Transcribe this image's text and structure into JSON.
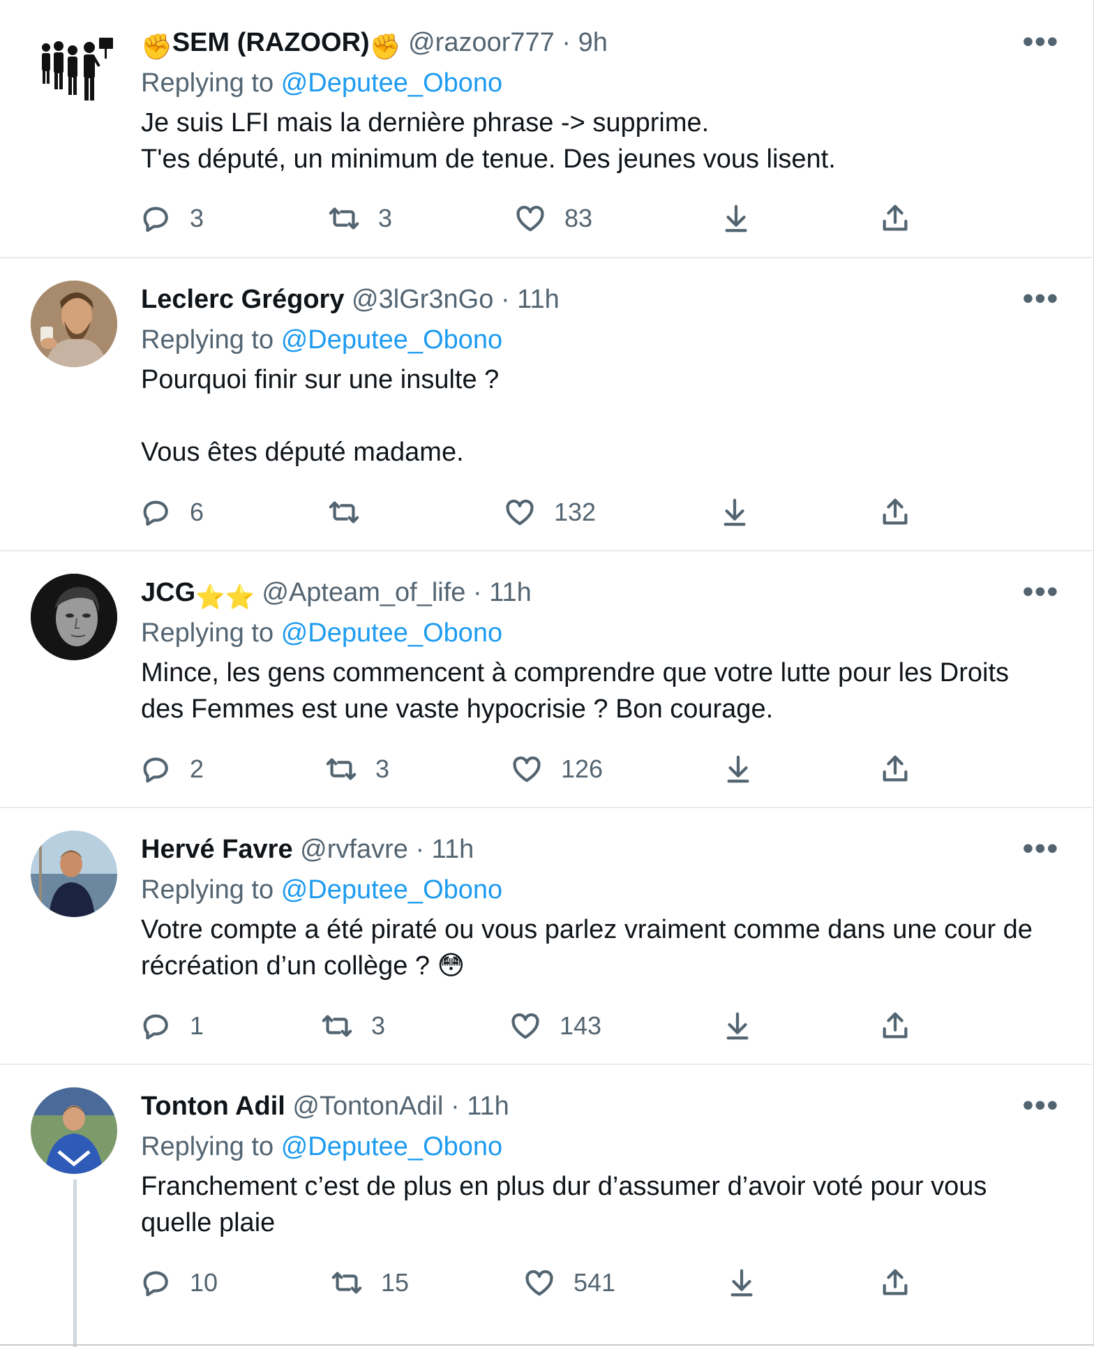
{
  "replying_label": "Replying to",
  "colors": {
    "accent": "#1d9bf0",
    "muted": "#536471",
    "text": "#0f1419",
    "divider": "#e6ecf0"
  },
  "icons": [
    "reply-icon",
    "retweet-icon",
    "like-icon",
    "download-icon",
    "share-icon",
    "more-icon"
  ],
  "tweets": [
    {
      "name": "SEM (RAZOOR)",
      "name_prefix_emoji": "✊",
      "name_suffix_emoji": "✊",
      "handle": "@razoor777",
      "sep": "·",
      "time": "9h",
      "reply_to": "@Deputee_Obono",
      "lines": [
        "Je suis LFI mais la dernière phrase -> supprime.",
        "T'es député, un minimum de tenue. Des jeunes vous lisent."
      ],
      "replies": "3",
      "retweets": "3",
      "likes": "83"
    },
    {
      "name": "Leclerc Grégory",
      "handle": "@3lGr3nGo",
      "sep": "·",
      "time": "11h",
      "reply_to": "@Deputee_Obono",
      "lines": [
        "Pourquoi finir sur une insulte ?",
        "",
        "Vous êtes député madame."
      ],
      "replies": "6",
      "retweets": "",
      "likes": "132"
    },
    {
      "name": "JCG",
      "name_suffix_emoji": "⭐⭐",
      "handle": "@Apteam_of_life",
      "sep": "·",
      "time": "11h",
      "reply_to": "@Deputee_Obono",
      "lines": [
        "Mince, les gens commencent à comprendre que votre lutte pour les Droits",
        "des Femmes est une vaste hypocrisie ? Bon courage."
      ],
      "replies": "2",
      "retweets": "3",
      "likes": "126"
    },
    {
      "name": "Hervé Favre",
      "handle": "@rvfavre",
      "sep": "·",
      "time": "11h",
      "reply_to": "@Deputee_Obono",
      "lines": [
        "Votre compte a été piraté ou vous parlez vraiment comme dans une cour de",
        "récréation d’un collège ? 😳"
      ],
      "replies": "1",
      "retweets": "3",
      "likes": "143"
    },
    {
      "name": "Tonton Adil",
      "handle": "@TontonAdil",
      "sep": "·",
      "time": "11h",
      "reply_to": "@Deputee_Obono",
      "lines": [
        "Franchement c’est de plus en plus dur d’assumer d’avoir voté pour vous",
        "quelle plaie"
      ],
      "replies": "10",
      "retweets": "15",
      "likes": "541"
    }
  ]
}
